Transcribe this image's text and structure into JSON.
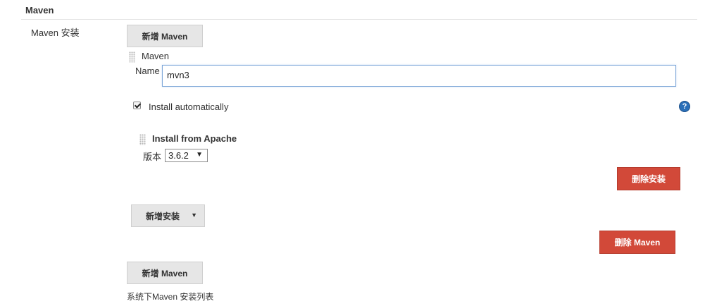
{
  "section": {
    "title": "Maven"
  },
  "maven_install": {
    "label": "Maven 安装",
    "add_maven_top": "新增 Maven",
    "item_header": "Maven",
    "name_label": "Name",
    "name_value": "mvn3",
    "install_auto_label": "Install automatically",
    "install_auto_checked": true,
    "help_icon": "help-icon",
    "installer": {
      "title": "Install from Apache",
      "version_label": "版本",
      "version_value": "3.6.2"
    },
    "delete_installer": "删除安装",
    "add_installer": "新增安装",
    "delete_maven": "删除 Maven",
    "add_maven_bottom": "新增 Maven",
    "footer_note": "系统下Maven 安装列表"
  },
  "colors": {
    "danger": "#d24939",
    "button_gray": "#e6e6e6",
    "focus_border": "#7ea7d8",
    "help_blue": "#2a6fb8"
  }
}
